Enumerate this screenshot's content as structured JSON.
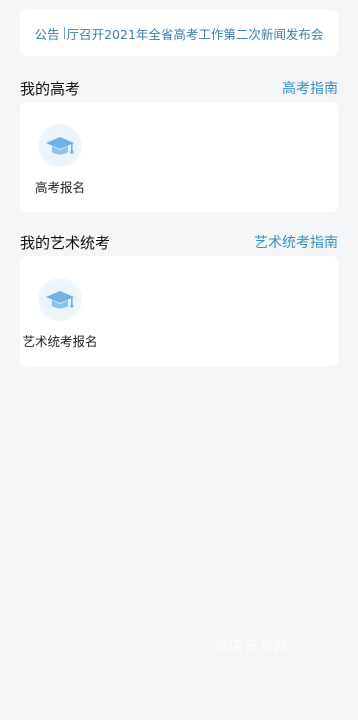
{
  "notice": {
    "prefix": "公告",
    "text": "厅召开2021年全省高考工作第二次新闻发布会"
  },
  "sections": [
    {
      "title": "我的高考",
      "link": "高考指南",
      "tiles": [
        {
          "label": "高考报名",
          "icon": "graduation-cap-icon"
        }
      ]
    },
    {
      "title": "我的艺术统考",
      "link": "艺术统考指南",
      "tiles": [
        {
          "label": "艺术统考报名",
          "icon": "graduation-cap-icon"
        }
      ]
    }
  ],
  "watermark": "商店安卓网",
  "colors": {
    "accent": "#3a8ec0",
    "notice_text": "#3f7fa6",
    "background": "#f5f6f8",
    "card": "#ffffff"
  }
}
